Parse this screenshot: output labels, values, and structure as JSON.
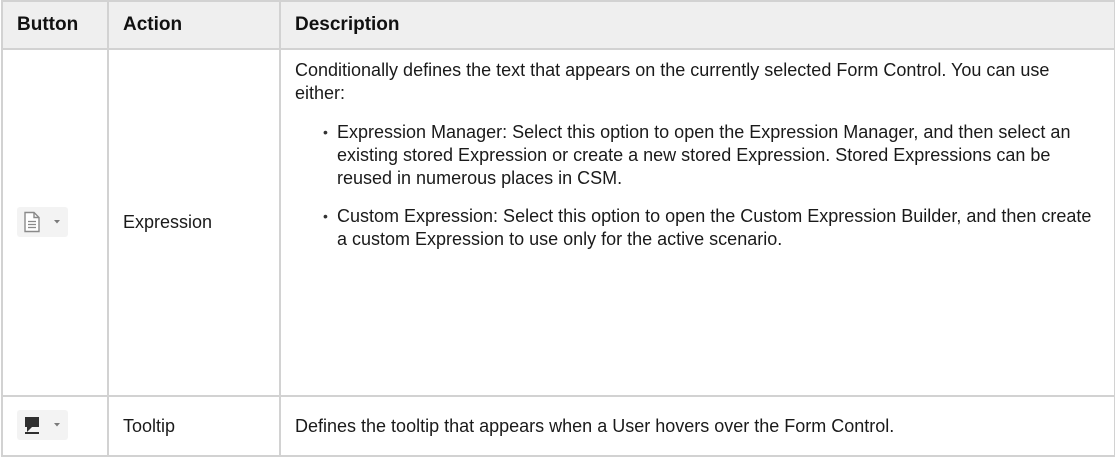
{
  "table": {
    "headers": [
      "Button",
      "Action",
      "Description"
    ],
    "rows": [
      {
        "icon": "document-icon",
        "action": "Expression",
        "description": "Conditionally defines the text that appears on the currently selected Form Control. You can use either:",
        "bullets": [
          "Expression Manager: Select this option to open the Expression Manager, and then select an existing stored Expression or create a new stored Expression. Stored Expressions can be reused in numerous places in CSM.",
          "Custom Expression: Select this option to open the Custom Expression Builder, and then create a custom Expression to use only for the active scenario."
        ]
      },
      {
        "icon": "tooltip-icon",
        "action": "Tooltip",
        "description": "Defines the tooltip that appears when a User hovers over the Form Control."
      }
    ]
  }
}
